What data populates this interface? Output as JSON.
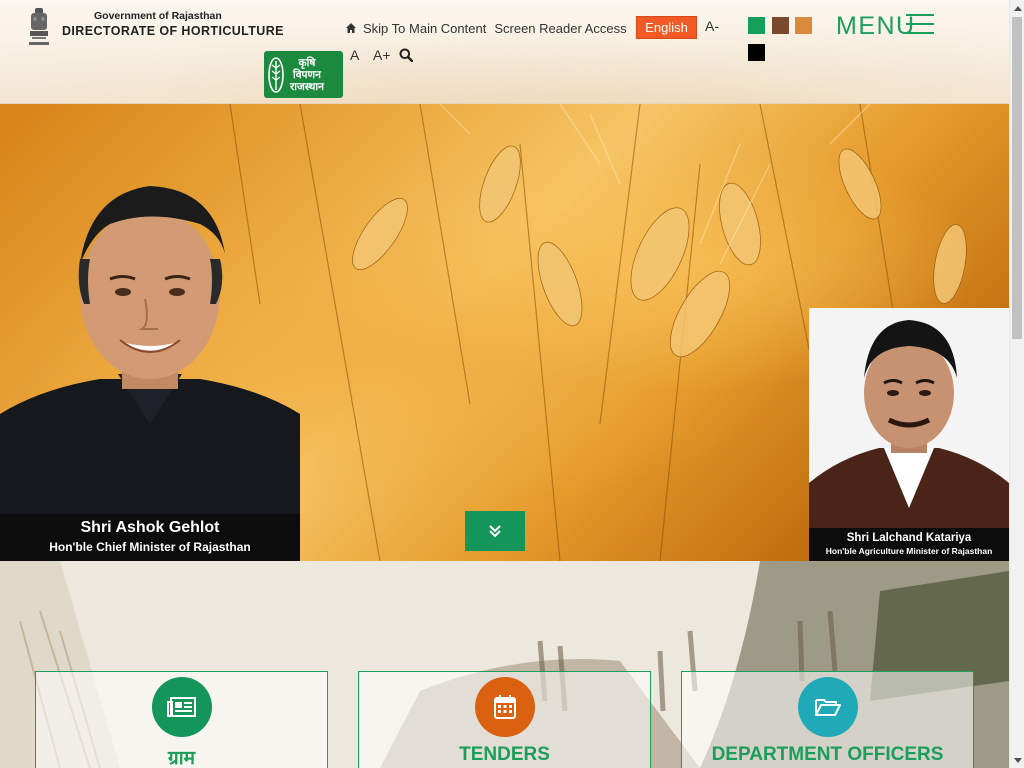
{
  "header": {
    "gov_title": "Government of Rajasthan",
    "dept_title": "DIRECTORATE OF HORTICULTURE",
    "skip_link": "Skip To Main Content",
    "screen_reader": "Screen Reader Access",
    "language": "English",
    "font_decrease": "A-",
    "font_normal": "A",
    "font_increase": "A+",
    "menu_label": "MENU",
    "krishi_logo": {
      "line1": "कृषि",
      "line2": "विपणन",
      "line3": "राजस्थान"
    },
    "theme_colors": {
      "green": "#14a05a",
      "brown": "#7b4a2e",
      "orange": "#d98a3a",
      "black": "#000000"
    }
  },
  "hero": {
    "left_person": {
      "name": "Shri Ashok Gehlot",
      "role": "Hon'ble Chief Minister of Rajasthan"
    },
    "right_person": {
      "name": "Shri Lalchand Katariya",
      "role": "Hon'ble Agriculture Minister of Rajasthan"
    }
  },
  "cards": [
    {
      "title": "ग्राम",
      "icon": "newspaper-icon",
      "color": "#14955a"
    },
    {
      "title": "TENDERS",
      "icon": "calendar-icon",
      "color": "#d9610f"
    },
    {
      "title": "DEPARTMENT OFFICERS",
      "icon": "folder-open-icon",
      "color": "#20a9b6"
    }
  ]
}
